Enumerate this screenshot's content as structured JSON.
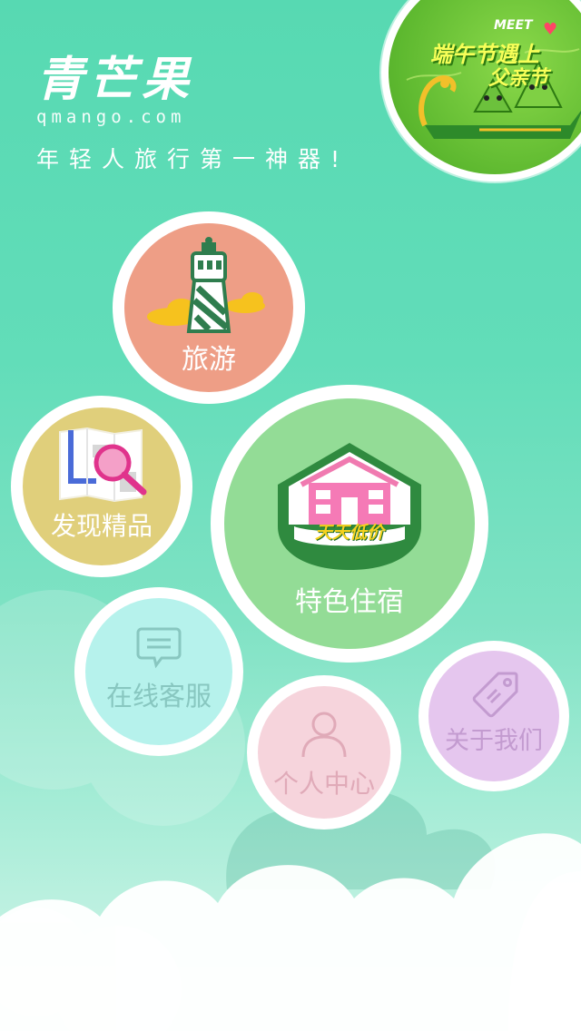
{
  "brand": {
    "name": "青芒果",
    "url": "qmango.com",
    "slogan": "年轻人旅行第一神器!"
  },
  "festival": {
    "meet": "MEET",
    "line1": "端午节遇上",
    "line2": "父亲节"
  },
  "menu": {
    "travel": {
      "label": "旅游",
      "icon": "lighthouse-icon",
      "color": "#ee9e86"
    },
    "discover": {
      "label": "发现精品",
      "icon": "map-search-icon",
      "color": "#e0cf7b"
    },
    "hotel": {
      "label": "特色住宿",
      "badge": "天天低价",
      "icon": "house-icon",
      "color": "#93dc96"
    },
    "service": {
      "label": "在线客服",
      "icon": "chat-icon",
      "color": "#b6f2ec"
    },
    "profile": {
      "label": "个人中心",
      "icon": "person-icon",
      "color": "#f6d4dc"
    },
    "about": {
      "label": "关于我们",
      "icon": "tag-icon",
      "color": "#e5c6ee"
    }
  }
}
